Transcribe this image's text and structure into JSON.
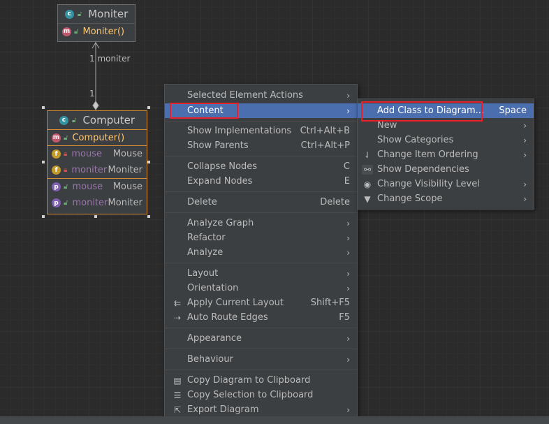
{
  "diagram": {
    "moniter_class": {
      "name": "Moniter",
      "constructor": "Moniter()"
    },
    "computer_class": {
      "name": "Computer",
      "constructor": "Computer()",
      "members": [
        {
          "kind": "f",
          "name": "mouse",
          "type": "Mouse"
        },
        {
          "kind": "f",
          "name": "moniter",
          "type": "Moniter"
        },
        {
          "kind": "p",
          "name": "mouse",
          "type": "Mouse"
        },
        {
          "kind": "p",
          "name": "moniter",
          "type": "Moniter"
        }
      ]
    },
    "edge": {
      "label_top": "1 moniter",
      "label_bottom": "1"
    }
  },
  "context_menu": {
    "items": [
      {
        "label": "Selected Element Actions",
        "arrow": true
      },
      {
        "label": "Content",
        "arrow": true,
        "highlighted": true
      },
      {
        "label": "Show Implementations",
        "shortcut": "Ctrl+Alt+B"
      },
      {
        "label": "Show Parents",
        "shortcut": "Ctrl+Alt+P"
      },
      {
        "label": "Collapse Nodes",
        "shortcut": "C"
      },
      {
        "label": "Expand Nodes",
        "shortcut": "E"
      },
      {
        "label": "Delete",
        "shortcut": "Delete"
      },
      {
        "label": "Analyze Graph",
        "arrow": true
      },
      {
        "label": "Refactor",
        "arrow": true
      },
      {
        "label": "Analyze",
        "arrow": true
      },
      {
        "label": "Layout",
        "arrow": true
      },
      {
        "label": "Orientation",
        "arrow": true
      },
      {
        "label": "Apply Current Layout",
        "shortcut": "Shift+F5",
        "icon": "apply-layout-icon"
      },
      {
        "label": "Auto Route Edges",
        "shortcut": "F5",
        "icon": "route-edges-icon"
      },
      {
        "label": "Appearance",
        "arrow": true
      },
      {
        "label": "Behaviour",
        "arrow": true
      },
      {
        "label": "Copy Diagram to Clipboard",
        "icon": "copy-diagram-icon"
      },
      {
        "label": "Copy Selection to Clipboard",
        "icon": "copy-selection-icon"
      },
      {
        "label": "Export Diagram",
        "arrow": true,
        "icon": "export-icon"
      }
    ]
  },
  "submenu": {
    "items": [
      {
        "label": "Add Class to Diagram...",
        "shortcut": "Space",
        "highlighted": true
      },
      {
        "label": "New",
        "arrow": true
      },
      {
        "label": "Show Categories",
        "arrow": true
      },
      {
        "label": "Change Item Ordering",
        "arrow": true,
        "icon": "sort-icon"
      },
      {
        "label": "Show Dependencies",
        "icon": "link-icon"
      },
      {
        "label": "Change Visibility Level",
        "arrow": true,
        "icon": "eye-icon"
      },
      {
        "label": "Change Scope",
        "arrow": true,
        "icon": "filter-icon"
      }
    ]
  },
  "colors": {
    "highlight": "#4b6eaf",
    "annotation_red": "#e8202a",
    "method_color": "#ffc66d",
    "field_color": "#9876aa"
  }
}
